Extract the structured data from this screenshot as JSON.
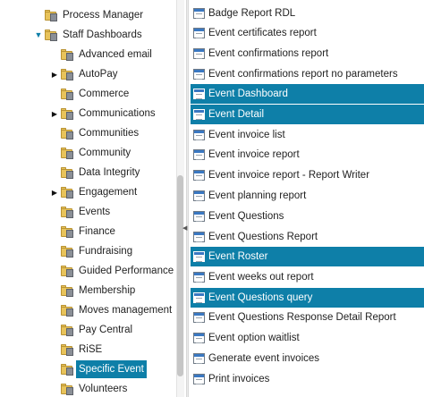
{
  "tree": {
    "items": [
      {
        "label": "Process Manager"
      },
      {
        "label": "Staff Dashboards",
        "expander": "▼"
      },
      {
        "label": "Advanced email"
      },
      {
        "label": "AutoPay",
        "expander": "▶"
      },
      {
        "label": "Commerce"
      },
      {
        "label": "Communications",
        "expander": "▶"
      },
      {
        "label": "Communities"
      },
      {
        "label": "Community"
      },
      {
        "label": "Data Integrity"
      },
      {
        "label": "Engagement",
        "expander": "▶"
      },
      {
        "label": "Events"
      },
      {
        "label": "Finance"
      },
      {
        "label": "Fundraising"
      },
      {
        "label": "Guided Performance Sc"
      },
      {
        "label": "Membership"
      },
      {
        "label": "Moves management"
      },
      {
        "label": "Pay Central"
      },
      {
        "label": "RiSE"
      },
      {
        "label": "Specific Event"
      },
      {
        "label": "Volunteers"
      }
    ]
  },
  "reports": {
    "items": [
      {
        "label": "Badge Report RDL"
      },
      {
        "label": "Event certificates report"
      },
      {
        "label": "Event confirmations report"
      },
      {
        "label": "Event confirmations report no parameters"
      },
      {
        "label": "Event Dashboard"
      },
      {
        "label": "Event Detail"
      },
      {
        "label": "Event invoice list"
      },
      {
        "label": "Event invoice report"
      },
      {
        "label": "Event invoice report - Report Writer"
      },
      {
        "label": "Event planning report"
      },
      {
        "label": "Event Questions"
      },
      {
        "label": "Event Questions Report"
      },
      {
        "label": "Event Roster"
      },
      {
        "label": "Event weeks out report"
      },
      {
        "label": "Event Questions query"
      },
      {
        "label": "Event Questions Response Detail Report"
      },
      {
        "label": "Event option waitlist"
      },
      {
        "label": "Generate event invoices"
      },
      {
        "label": "Print invoices"
      }
    ]
  },
  "colors": {
    "selection": "#0e7fa8",
    "folder": "#e8c35a"
  }
}
